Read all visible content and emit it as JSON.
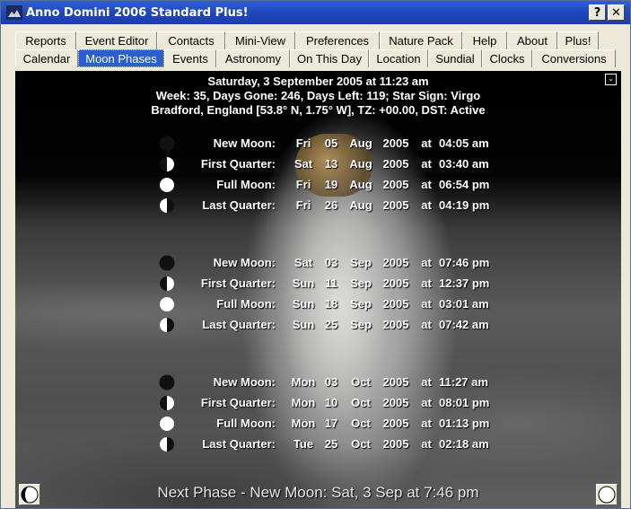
{
  "window": {
    "title": "Anno Domini 2006 Standard Plus!",
    "help_btn": "?",
    "close_btn": "✕"
  },
  "tabs_top": [
    "Reports",
    "Event Editor",
    "Contacts",
    "Mini-View",
    "Preferences",
    "Nature Pack",
    "Help",
    "About",
    "Plus!"
  ],
  "tabs_bottom": [
    "Calendar",
    "Moon Phases",
    "Events",
    "Astronomy",
    "On This Day",
    "Location",
    "Sundial",
    "Clocks",
    "Conversions"
  ],
  "active_tab": "Moon Phases",
  "header": {
    "line1": "Saturday, 3 September 2005 at 11:23 am",
    "line2": "Week: 35, Days Gone: 246, Days Left: 119; Star Sign: Virgo",
    "line3": "Bradford, England [53.8° N, 1.75° W], TZ: +00.00, DST: Active"
  },
  "phases": [
    {
      "name": "New Moon:",
      "day": "Fri",
      "date": "05",
      "month": "Aug",
      "year": "2005",
      "at": "at",
      "time": "04:05 am",
      "icon": "new-moon"
    },
    {
      "name": "First Quarter:",
      "day": "Sat",
      "date": "13",
      "month": "Aug",
      "year": "2005",
      "at": "at",
      "time": "03:40 am",
      "icon": "first-quarter"
    },
    {
      "name": "Full Moon:",
      "day": "Fri",
      "date": "19",
      "month": "Aug",
      "year": "2005",
      "at": "at",
      "time": "06:54 pm",
      "icon": "full-moon"
    },
    {
      "name": "Last Quarter:",
      "day": "Fri",
      "date": "26",
      "month": "Aug",
      "year": "2005",
      "at": "at",
      "time": "04:19 pm",
      "icon": "last-quarter"
    },
    {
      "name": "New Moon:",
      "day": "Sat",
      "date": "03",
      "month": "Sep",
      "year": "2005",
      "at": "at",
      "time": "07:46 pm",
      "icon": "new-moon"
    },
    {
      "name": "First Quarter:",
      "day": "Sun",
      "date": "11",
      "month": "Sep",
      "year": "2005",
      "at": "at",
      "time": "12:37 pm",
      "icon": "first-quarter"
    },
    {
      "name": "Full Moon:",
      "day": "Sun",
      "date": "18",
      "month": "Sep",
      "year": "2005",
      "at": "at",
      "time": "03:01 am",
      "icon": "full-moon"
    },
    {
      "name": "Last Quarter:",
      "day": "Sun",
      "date": "25",
      "month": "Sep",
      "year": "2005",
      "at": "at",
      "time": "07:42 am",
      "icon": "last-quarter"
    },
    {
      "name": "New Moon:",
      "day": "Mon",
      "date": "03",
      "month": "Oct",
      "year": "2005",
      "at": "at",
      "time": "11:27 am",
      "icon": "new-moon"
    },
    {
      "name": "First Quarter:",
      "day": "Mon",
      "date": "10",
      "month": "Oct",
      "year": "2005",
      "at": "at",
      "time": "08:01 pm",
      "icon": "first-quarter"
    },
    {
      "name": "Full Moon:",
      "day": "Mon",
      "date": "17",
      "month": "Oct",
      "year": "2005",
      "at": "at",
      "time": "01:13 pm",
      "icon": "full-moon"
    },
    {
      "name": "Last Quarter:",
      "day": "Tue",
      "date": "25",
      "month": "Oct",
      "year": "2005",
      "at": "at",
      "time": "02:18 am",
      "icon": "last-quarter"
    }
  ],
  "footer": {
    "next_phase": "Next Phase - New Moon:  Sat,  3  Sep  at  7:46 pm"
  },
  "colors": {
    "title_bar": "#1e46b8",
    "active_tab": "#2a5fcd",
    "text": "#ffffff"
  }
}
